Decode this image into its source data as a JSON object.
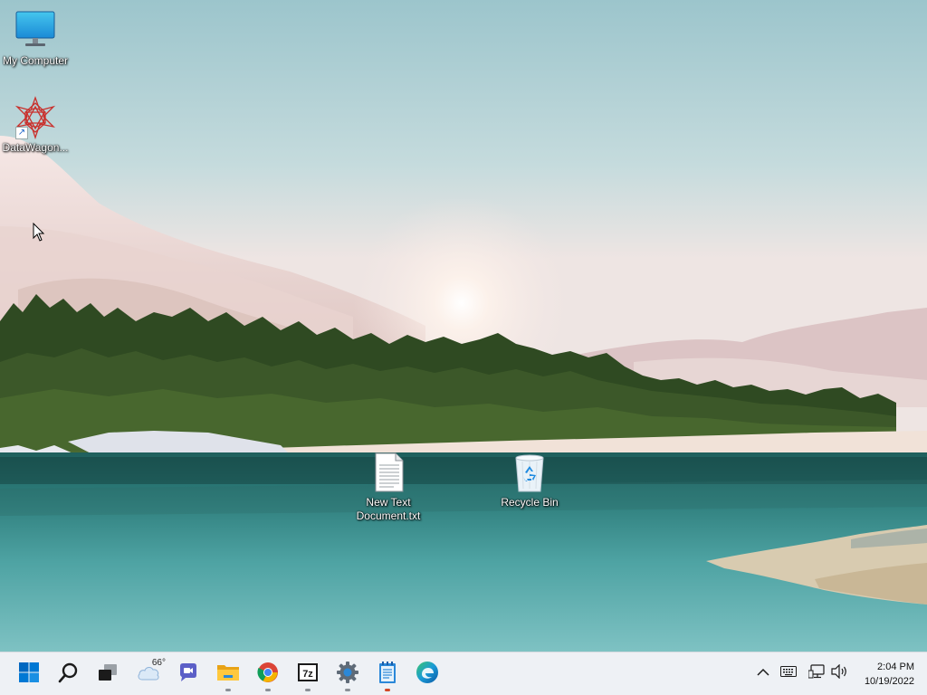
{
  "desktop": {
    "icons": [
      {
        "label": "My Computer"
      },
      {
        "label": "DataWagon..."
      },
      {
        "label": "New Text Document.txt"
      },
      {
        "label": "Recycle Bin"
      }
    ]
  },
  "taskbar": {
    "weather_temp": "66°",
    "pinned": [
      {
        "name": "start",
        "icon": "windows-logo-icon"
      },
      {
        "name": "search",
        "icon": "search-icon"
      },
      {
        "name": "task-view",
        "icon": "task-view-icon"
      },
      {
        "name": "weather",
        "icon": "cloud-icon"
      },
      {
        "name": "chat",
        "icon": "chat-icon"
      },
      {
        "name": "file-explorer",
        "icon": "folder-icon"
      },
      {
        "name": "chrome",
        "icon": "chrome-icon"
      },
      {
        "name": "7zip",
        "icon": "7zip-icon"
      },
      {
        "name": "settings",
        "icon": "gear-icon"
      },
      {
        "name": "notepad",
        "icon": "notepad-icon"
      },
      {
        "name": "edge",
        "icon": "edge-icon"
      }
    ],
    "tray": {
      "time": "2:04 PM",
      "date": "10/19/2022"
    },
    "colors": {
      "accent": "#0067c0",
      "bar_bg": "#eef1f5",
      "active_indicator": "#d24726"
    }
  }
}
